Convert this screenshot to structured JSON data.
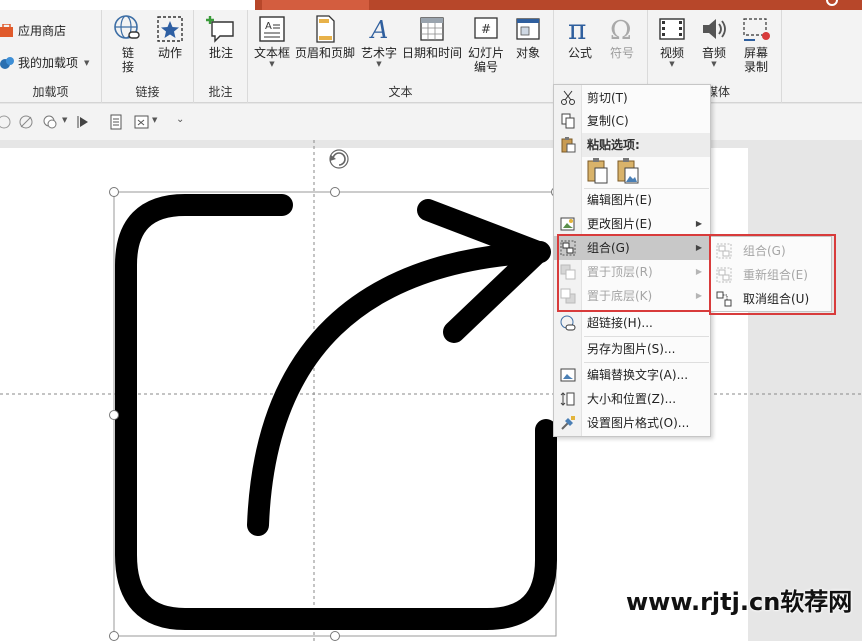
{
  "ribbon": {
    "addins": {
      "app_store": "应用商店",
      "my_addins": "我的加载项",
      "group_label": "加载项"
    },
    "links": {
      "link": "链\n接",
      "link_top": "链",
      "link_bottom": "接",
      "action": "动作",
      "group_label": "链接"
    },
    "comments": {
      "comment": "批注",
      "group_label": "批注"
    },
    "text": {
      "textbox": "文本框",
      "header_footer": "页眉和页脚",
      "wordart": "艺术字",
      "datetime": "日期和时间",
      "slide_number_line1": "幻灯片",
      "slide_number_line2": "编号",
      "object": "对象",
      "group_label": "文本"
    },
    "symbols": {
      "equation": "公式",
      "symbol": "符号"
    },
    "media": {
      "video": "视频",
      "audio": "音频",
      "screen_rec_line1": "屏幕",
      "screen_rec_line2": "录制",
      "group_label_partial": "媒体"
    }
  },
  "context_menu": {
    "cut": "剪切(T)",
    "copy": "复制(C)",
    "paste_options": "粘贴选项:",
    "edit_picture": "编辑图片(E)",
    "change_picture": "更改图片(E)",
    "group": "组合(G)",
    "bring_to_front": "置于顶层(R)",
    "send_to_back": "置于底层(K)",
    "hyperlink": "超链接(H)...",
    "save_as_picture": "另存为图片(S)...",
    "edit_alt_text": "编辑替换文字(A)...",
    "size_position": "大小和位置(Z)...",
    "format_picture": "设置图片格式(O)..."
  },
  "submenu": {
    "group": "组合(G)",
    "regroup": "重新组合(E)",
    "ungroup": "取消组合(U)"
  },
  "watermark": "www.rjtj.cn软荐网",
  "colors": {
    "accent_red": "#d83b3b",
    "title_orange": "#b7472a",
    "menu_highlight": "#c8c8c8"
  }
}
